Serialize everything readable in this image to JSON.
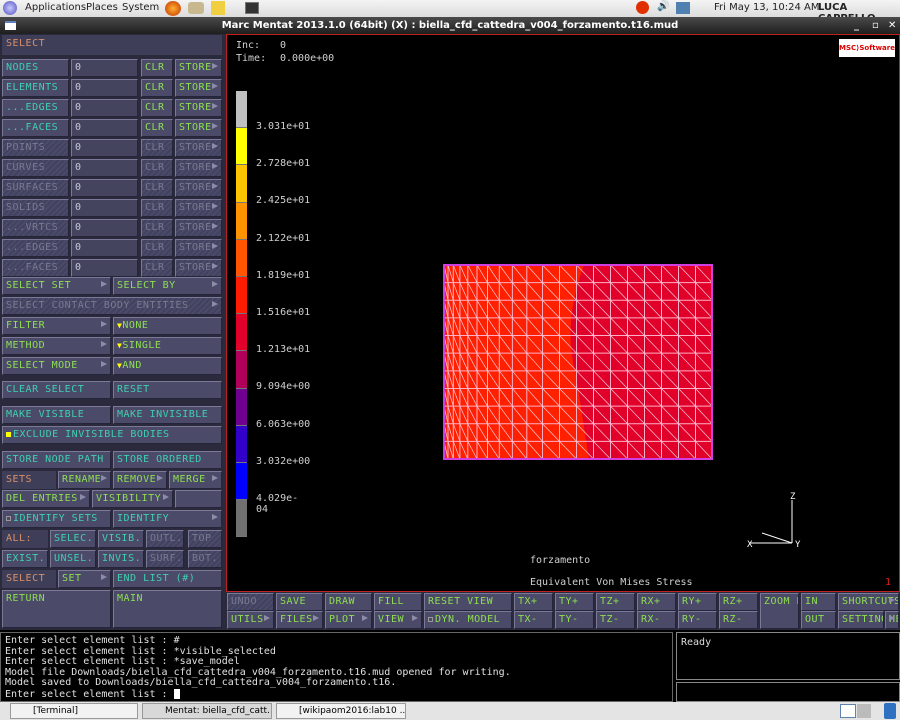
{
  "top_panel": {
    "applications": "Applications",
    "places": "Places",
    "system": "System",
    "clock": "Fri May 13, 10:24 AM",
    "user": "LUCA CAPPELLO"
  },
  "window": {
    "title": "Marc Mentat 2013.1.0 (64bit) (X) : biella_cfd_cattedra_v004_forzamento.t16.mud"
  },
  "left": {
    "header": "SELECT",
    "entities": [
      {
        "label": "NODES",
        "value": "0",
        "enabled": true
      },
      {
        "label": "ELEMENTS",
        "value": "0",
        "enabled": true
      },
      {
        "label": "...EDGES",
        "value": "0",
        "enabled": true
      },
      {
        "label": "...FACES",
        "value": "0",
        "enabled": true
      },
      {
        "label": "POINTS",
        "value": "0",
        "enabled": false
      },
      {
        "label": "CURVES",
        "value": "0",
        "enabled": false
      },
      {
        "label": "SURFACES",
        "value": "0",
        "enabled": false
      },
      {
        "label": "SOLIDS",
        "value": "0",
        "enabled": false
      },
      {
        "label": "...VRTCS",
        "value": "0",
        "enabled": false
      },
      {
        "label": "...EDGES",
        "value": "0",
        "enabled": false
      },
      {
        "label": "...FACES",
        "value": "0",
        "enabled": false
      }
    ],
    "clr": "CLR",
    "store": "STORE",
    "select_set": "SELECT SET",
    "select_by": "SELECT BY",
    "select_contact": "SELECT CONTACT BODY ENTITIES",
    "filter": "FILTER",
    "filter_value": "NONE",
    "method": "METHOD",
    "method_value": "SINGLE",
    "select_mode": "SELECT MODE",
    "select_mode_value": "AND",
    "clear_select": "CLEAR SELECT",
    "reset": "RESET",
    "make_visible": "MAKE VISIBLE",
    "make_invisible": "MAKE INVISIBLE",
    "exclude_invisible": "EXCLUDE INVISIBLE BODIES",
    "exclude_checked": true,
    "store_node_path": "STORE NODE PATH",
    "store_ordered": "STORE ORDERED",
    "sets": "SETS",
    "rename": "RENAME",
    "remove": "REMOVE",
    "merge": "MERGE",
    "del_entries": "DEL ENTRIES",
    "visibility": "VISIBILITY",
    "identify_sets": "IDENTIFY SETS",
    "identify": "IDENTIFY",
    "all": "ALL:",
    "selec": "SELEC.",
    "visib": "VISIB.",
    "outl": "OUTL.",
    "top": "TOP",
    "exist": "EXIST.",
    "unsel": "UNSEL.",
    "invis": "INVIS.",
    "surf": "SURF.",
    "bot": "BOT.",
    "select": "SELECT",
    "set": "SET",
    "end_list": "END LIST (#)",
    "return": "RETURN",
    "main": "MAIN"
  },
  "viewport": {
    "inc_label": "Inc:",
    "inc_value": "0",
    "time_label": "Time:",
    "time_value": "0.000e+00",
    "logo": "MSC Software",
    "legend_labels": [
      "3.031e+01",
      "2.728e+01",
      "2.425e+01",
      "2.122e+01",
      "1.819e+01",
      "1.516e+01",
      "1.213e+01",
      "9.094e+00",
      "6.063e+00",
      "3.032e+00",
      "4.029e-04"
    ],
    "legend_colors": [
      "#c0c0c0",
      "#ffff00",
      "#ffc400",
      "#ff9400",
      "#ff5400",
      "#ff1c00",
      "#e0002a",
      "#b0005a",
      "#700090",
      "#3200c8",
      "#0000ff",
      "#707070"
    ],
    "loadcase": "forzamento",
    "quantity": "Equivalent Von Mises Stress",
    "view_number": "1",
    "axis_z": "Z",
    "axis_y": "Y",
    "axis_x": "X"
  },
  "toolbar": {
    "row1": [
      "UNDO",
      "SAVE",
      "DRAW",
      "FILL",
      "RESET VIEW",
      "TX+",
      "TY+",
      "TZ+",
      "RX+",
      "RY+",
      "RZ+",
      "ZOOM BOX",
      "IN",
      "SHORTCUTS"
    ],
    "row2": [
      "UTILS",
      "FILES",
      "PLOT",
      "VIEW",
      "DYN. MODEL",
      "TX-",
      "TY-",
      "TZ-",
      "RX-",
      "RY-",
      "RZ-",
      "OUT",
      "SETTINGS",
      "HELP"
    ]
  },
  "console": {
    "lines": [
      "Enter select element list : #",
      "Enter select element list : *visible_selected",
      "Enter select element list : *save_model",
      "Model file Downloads/biella_cfd_cattedra_v004_forzamento.t16.mud opened for writing.",
      "Model saved to Downloads/biella_cfd_cattedra_v004_forzamento.t16.",
      "Enter select element list : "
    ]
  },
  "status": {
    "text": "Ready"
  },
  "taskbar": {
    "items": [
      "[Terminal]",
      "Mentat: biella_cfd_catt...",
      "[wikipaom2016:lab10 ..."
    ]
  }
}
